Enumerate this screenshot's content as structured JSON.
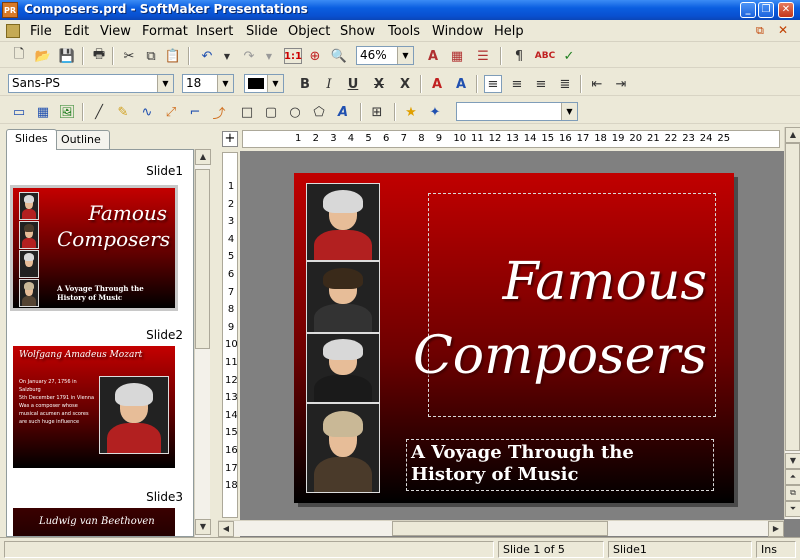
{
  "window": {
    "title": "Composers.prd - SoftMaker Presentations",
    "app_icon_text": "PR"
  },
  "menu": {
    "items": [
      "File",
      "Edit",
      "View",
      "Format",
      "Insert",
      "Slide",
      "Object",
      "Show",
      "Tools",
      "Window",
      "Help"
    ]
  },
  "toolbar": {
    "zoom_value": "46%"
  },
  "format_bar": {
    "font_name": "Sans-PS",
    "font_size": "18"
  },
  "left_panel": {
    "tabs": [
      "Slides",
      "Outline"
    ],
    "active_tab": "Slides",
    "thumbnails": [
      {
        "label": "Slide1",
        "title_line1": "Famous",
        "title_line2": "Composers",
        "subtitle_line1": "A Voyage Through the",
        "subtitle_line2": "History of Music"
      },
      {
        "label": "Slide2",
        "heading": "Wolfgang Amadeus Mozart",
        "bullets": [
          "On January 27, 1756 in Salzburg",
          "5th December 1791 in Vienna",
          "Was a composer whose musical acumen and scores are such huge influence"
        ]
      },
      {
        "label": "Slide3",
        "heading": "Ludwig van Beethoven"
      }
    ]
  },
  "rulers": {
    "horizontal": [
      "1",
      "2",
      "3",
      "4",
      "5",
      "6",
      "7",
      "8",
      "9",
      "10",
      "11",
      "12",
      "13",
      "14",
      "15",
      "16",
      "17",
      "18",
      "19",
      "20",
      "21",
      "22",
      "23",
      "24",
      "25"
    ],
    "vertical": [
      "1",
      "2",
      "3",
      "4",
      "5",
      "6",
      "7",
      "8",
      "9",
      "10",
      "11",
      "12",
      "13",
      "14",
      "15",
      "16",
      "17",
      "18"
    ]
  },
  "slide": {
    "title_line1": "Famous",
    "title_line2": "Composers",
    "subtitle_line1": "A Voyage Through the",
    "subtitle_line2": "History of Music",
    "portraits": [
      "Mozart",
      "Beethoven",
      "Bach",
      "Handel"
    ]
  },
  "status": {
    "slide_position": "Slide 1 of 5",
    "slide_name": "Slide1",
    "mode": "Ins"
  }
}
